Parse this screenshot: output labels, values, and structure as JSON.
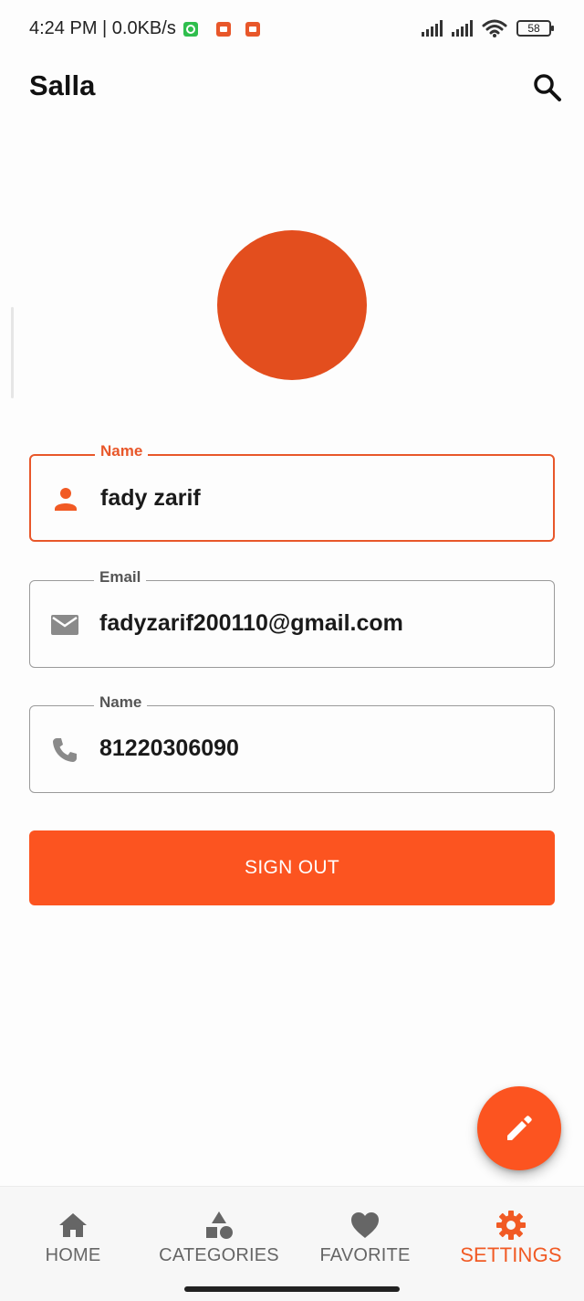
{
  "status_bar": {
    "time_speed": "4:24 PM | 0.0KB/s",
    "battery": "58"
  },
  "app_bar": {
    "title": "Salla",
    "search_icon": "search-icon"
  },
  "profile": {
    "avatar_color": "#e34e1e"
  },
  "fields": {
    "name": {
      "label": "Name",
      "value": "fady zarif",
      "icon": "person-icon"
    },
    "email": {
      "label": "Email",
      "value": "fadyzarif200110@gmail.com",
      "icon": "mail-icon"
    },
    "phone": {
      "label": "Name",
      "value": "81220306090",
      "icon": "phone-icon"
    }
  },
  "actions": {
    "sign_out_label": "SIGN OUT",
    "fab_icon": "edit-icon"
  },
  "bottom_nav": {
    "items": [
      {
        "label": "HOME",
        "icon": "home-icon"
      },
      {
        "label": "CATEGORIES",
        "icon": "categories-icon"
      },
      {
        "label": "FAVORITE",
        "icon": "heart-icon"
      },
      {
        "label": "SETTINGS",
        "icon": "gear-icon",
        "active": true
      }
    ]
  },
  "colors": {
    "accent": "#fc5420",
    "accent_text": "#f15a24",
    "muted": "#666666"
  }
}
